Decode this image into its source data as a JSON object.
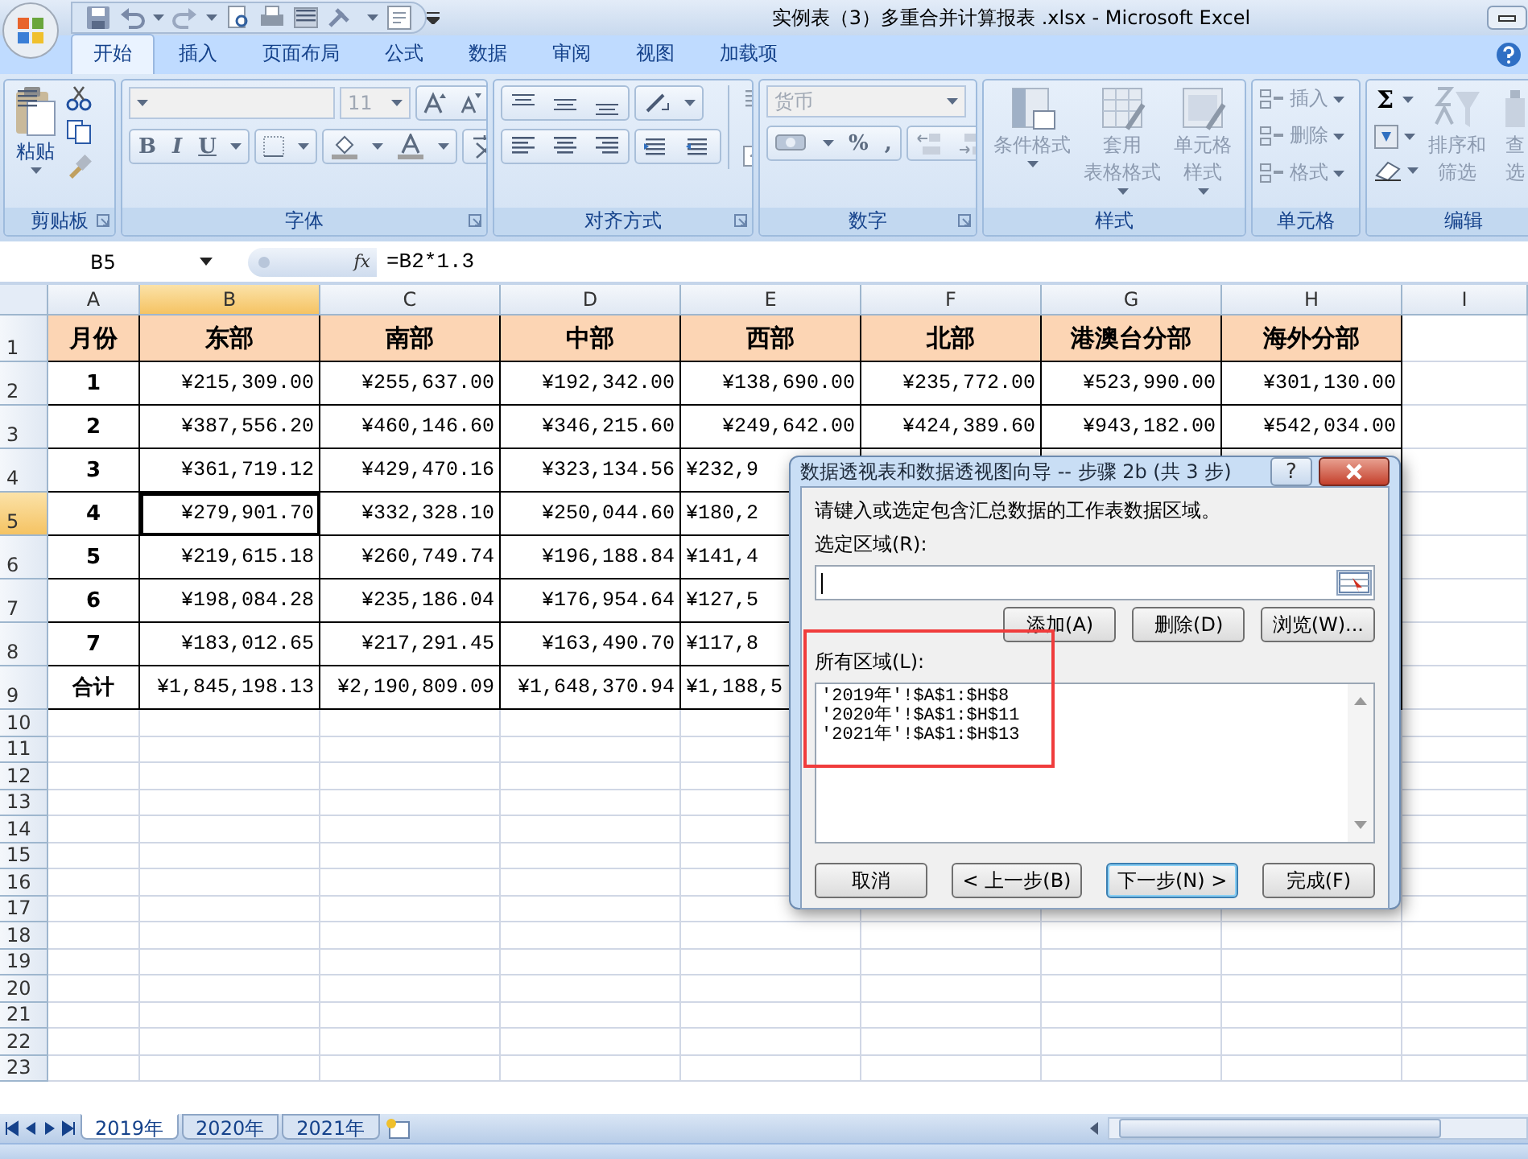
{
  "window": {
    "title": "实例表（3）多重合并计算报表 .xlsx - Microsoft Excel"
  },
  "ribbon_tabs": [
    {
      "label": "开始",
      "selected": true
    },
    {
      "label": "插入",
      "selected": false
    },
    {
      "label": "页面布局",
      "selected": false
    },
    {
      "label": "公式",
      "selected": false
    },
    {
      "label": "数据",
      "selected": false
    },
    {
      "label": "审阅",
      "selected": false
    },
    {
      "label": "视图",
      "selected": false
    },
    {
      "label": "加载项",
      "selected": false
    }
  ],
  "ribbon_groups": [
    {
      "kind": "clipboard",
      "label": "剪贴板",
      "paste": "粘贴"
    },
    {
      "kind": "font",
      "label": "字体",
      "font_size": "11",
      "style_buttons": [
        "B",
        "I",
        "U"
      ]
    },
    {
      "kind": "alignment",
      "label": "对齐方式"
    },
    {
      "kind": "number",
      "label": "数字",
      "format": "货币",
      "symbols": [
        "%",
        ","
      ]
    },
    {
      "kind": "large",
      "label": "样式",
      "buttons": [
        {
          "lines": [
            "条件格式"
          ],
          "disabled": true
        },
        {
          "lines": [
            "套用",
            "表格格式"
          ],
          "disabled": true
        },
        {
          "lines": [
            "单元格",
            "样式"
          ],
          "disabled": true
        }
      ]
    },
    {
      "kind": "cells",
      "label": "单元格",
      "buttons": [
        {
          "label": "插入",
          "disabled": true
        },
        {
          "label": "删除",
          "disabled": true
        },
        {
          "label": "格式",
          "disabled": true
        }
      ]
    },
    {
      "kind": "editing",
      "label": "编辑",
      "sum": "Σ",
      "buttons": [
        {
          "lines": [
            "排序和",
            "筛选"
          ],
          "disabled": true
        },
        {
          "lines": [
            "查",
            "选"
          ],
          "disabled": true
        }
      ]
    }
  ],
  "formula_bar": {
    "name_box": "B5",
    "function_label": "fx",
    "formula": "=B2*1.3"
  },
  "sheet": {
    "columns": [
      {
        "label": "A",
        "selected": false
      },
      {
        "label": "B",
        "selected": true
      },
      {
        "label": "C",
        "selected": false
      },
      {
        "label": "D",
        "selected": false
      },
      {
        "label": "E",
        "selected": false
      },
      {
        "label": "F",
        "selected": false
      },
      {
        "label": "G",
        "selected": false
      },
      {
        "label": "H",
        "selected": false
      },
      {
        "label": "I",
        "selected": false
      }
    ],
    "rows": [
      {
        "label": "1",
        "kind": "heading",
        "selected": false,
        "cells": [
          "月份",
          "东部",
          "南部",
          "中部",
          "西部",
          "北部",
          "港澳台分部",
          "海外分部"
        ]
      },
      {
        "label": "2",
        "kind": "data",
        "selected": false,
        "cells": [
          "1",
          "¥215,309.00",
          "¥255,637.00",
          "¥192,342.00",
          "¥138,690.00",
          "¥235,772.00",
          "¥523,990.00",
          "¥301,130.00"
        ]
      },
      {
        "label": "3",
        "kind": "data",
        "selected": false,
        "cells": [
          "2",
          "¥387,556.20",
          "¥460,146.60",
          "¥346,215.60",
          "¥249,642.00",
          "¥424,389.60",
          "¥943,182.00",
          "¥542,034.00"
        ]
      },
      {
        "label": "4",
        "kind": "data",
        "selected": false,
        "cells": [
          "3",
          "¥361,719.12",
          "¥429,470.16",
          "¥323,134.56",
          {
            "text": "¥232,9",
            "cut": true
          }
        ]
      },
      {
        "label": "5",
        "kind": "data",
        "selected": true,
        "cells": [
          "4",
          "¥279,901.70",
          "¥332,328.10",
          "¥250,044.60",
          {
            "text": "¥180,2",
            "cut": true
          }
        ]
      },
      {
        "label": "6",
        "kind": "data",
        "selected": false,
        "cells": [
          "5",
          "¥219,615.18",
          "¥260,749.74",
          "¥196,188.84",
          {
            "text": "¥141,4",
            "cut": true
          }
        ]
      },
      {
        "label": "7",
        "kind": "data",
        "selected": false,
        "cells": [
          "6",
          "¥198,084.28",
          "¥235,186.04",
          "¥176,954.64",
          {
            "text": "¥127,5",
            "cut": true
          }
        ]
      },
      {
        "label": "8",
        "kind": "data",
        "selected": false,
        "cells": [
          "7",
          "¥183,012.65",
          "¥217,291.45",
          "¥163,490.70",
          {
            "text": "¥117,8",
            "cut": true
          }
        ]
      },
      {
        "label": "9",
        "kind": "data",
        "selected": false,
        "cells": [
          "合计",
          "¥1,845,198.13",
          "¥2,190,809.09",
          "¥1,648,370.94",
          {
            "text": "¥1,188,5",
            "cut": true
          }
        ]
      },
      {
        "label": "10",
        "kind": "empty",
        "selected": false
      },
      {
        "label": "11",
        "kind": "empty",
        "selected": false
      },
      {
        "label": "12",
        "kind": "empty",
        "selected": false
      },
      {
        "label": "13",
        "kind": "empty",
        "selected": false
      },
      {
        "label": "14",
        "kind": "empty",
        "selected": false
      },
      {
        "label": "15",
        "kind": "empty",
        "selected": false
      },
      {
        "label": "16",
        "kind": "empty",
        "selected": false
      },
      {
        "label": "17",
        "kind": "empty",
        "selected": false
      },
      {
        "label": "18",
        "kind": "empty",
        "selected": false
      },
      {
        "label": "19",
        "kind": "empty",
        "selected": false
      },
      {
        "label": "20",
        "kind": "empty",
        "selected": false
      },
      {
        "label": "21",
        "kind": "empty",
        "selected": false
      },
      {
        "label": "22",
        "kind": "empty",
        "selected": false
      },
      {
        "label": "23",
        "kind": "empty",
        "selected": false
      }
    ]
  },
  "sheet_tabs": [
    {
      "label": "2019年",
      "selected": true
    },
    {
      "label": "2020年",
      "selected": false
    },
    {
      "label": "2021年",
      "selected": false
    }
  ],
  "dialog": {
    "title": "数据透视表和数据透视图向导 -- 步骤 2b (共 3 步)",
    "help": "?",
    "instruction": "请键入或选定包含汇总数据的工作表数据区域。",
    "range_label": "选定区域(R):",
    "range_buttons": [
      "添加(A)",
      "删除(D)",
      "浏览(W)..."
    ],
    "list_label": "所有区域(L):",
    "ranges": [
      "'2019年'!$A$1:$H$8",
      "'2020年'!$A$1:$H$11",
      "'2021年'!$A$1:$H$13"
    ],
    "buttons": [
      {
        "label": "取消",
        "default": false
      },
      {
        "label": "< 上一步(B)",
        "default": false
      },
      {
        "label": "下一步(N) >",
        "default": true
      },
      {
        "label": "完成(F)",
        "default": false
      }
    ]
  }
}
